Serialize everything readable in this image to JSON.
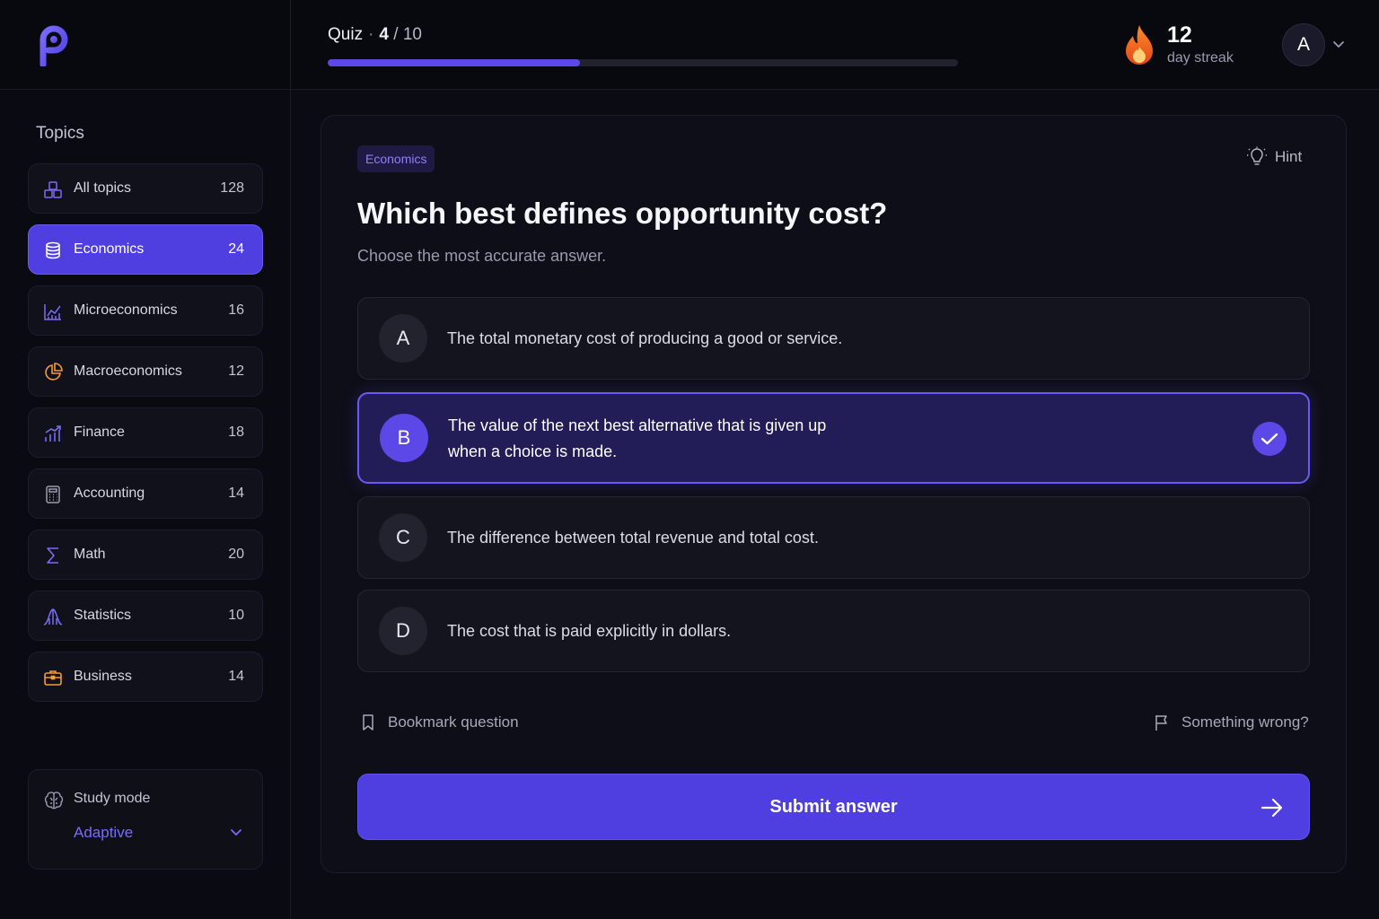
{
  "quiz": {
    "label": "Quiz",
    "separator": "·",
    "current": "4",
    "total": "/ 10",
    "progress_fraction": 0.4
  },
  "streak": {
    "count": "12",
    "label": "day streak"
  },
  "user": {
    "initial": "A"
  },
  "sidebar": {
    "title": "Topics",
    "items": [
      {
        "label": "All topics",
        "count": "128",
        "icon": "layers-icon"
      },
      {
        "label": "Economics",
        "count": "24",
        "icon": "database-icon",
        "active": true
      },
      {
        "label": "Microeconomics",
        "count": "16",
        "icon": "bar-chart-icon"
      },
      {
        "label": "Macroeconomics",
        "count": "12",
        "icon": "pie-chart-icon"
      },
      {
        "label": "Finance",
        "count": "18",
        "icon": "trending-up-icon"
      },
      {
        "label": "Accounting",
        "count": "14",
        "icon": "calculator-icon"
      },
      {
        "label": "Math",
        "count": "20",
        "icon": "sigma-icon"
      },
      {
        "label": "Statistics",
        "count": "10",
        "icon": "bell-curve-icon"
      },
      {
        "label": "Business",
        "count": "14",
        "icon": "briefcase-icon"
      }
    ],
    "study_mode": {
      "label": "Study mode",
      "value": "Adaptive"
    }
  },
  "question": {
    "tag": "Economics",
    "hint_label": "Hint",
    "title": "Which best defines opportunity cost?",
    "subtitle": "Choose the most accurate answer.",
    "options": [
      {
        "letter": "A",
        "text": "The total monetary cost of producing a good or service."
      },
      {
        "letter": "B",
        "text_line1": "The value of the next best alternative that is given up",
        "text_line2": "when a choice is made.",
        "selected": true
      },
      {
        "letter": "C",
        "text": "The difference between total revenue and total cost."
      },
      {
        "letter": "D",
        "text": "The cost that is paid explicitly in dollars."
      }
    ],
    "bookmark_label": "Bookmark question",
    "report_label": "Something wrong?",
    "submit_label": "Submit answer"
  },
  "colors": {
    "accent": "#5b48e6",
    "streak": "#f06a1f",
    "background": "#0b0b14"
  }
}
